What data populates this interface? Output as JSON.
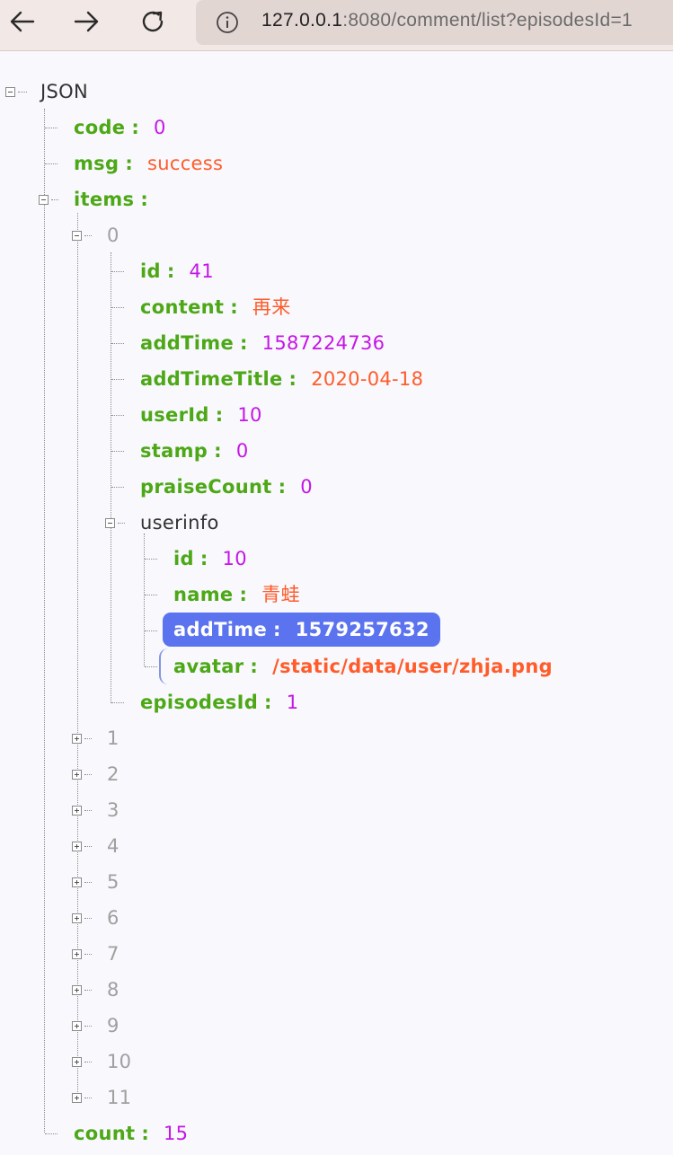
{
  "browser": {
    "url_host": "127.0.0.1",
    "url_rest": ":8080/comment/list?episodesId=1"
  },
  "tree": {
    "root_label": "JSON",
    "separator": ":",
    "code": {
      "key": "code",
      "value": "0"
    },
    "msg": {
      "key": "msg",
      "value": "success"
    },
    "items": {
      "key": "items",
      "first_item": {
        "index": "0",
        "id": {
          "key": "id",
          "value": "41"
        },
        "content": {
          "key": "content",
          "value": "再来"
        },
        "addTime": {
          "key": "addTime",
          "value": "1587224736"
        },
        "addTimeTitle": {
          "key": "addTimeTitle",
          "value": "2020-04-18"
        },
        "userId": {
          "key": "userId",
          "value": "10"
        },
        "stamp": {
          "key": "stamp",
          "value": "0"
        },
        "praiseCount": {
          "key": "praiseCount",
          "value": "0"
        },
        "userinfo": {
          "label": "userinfo",
          "id": {
            "key": "id",
            "value": "10"
          },
          "name": {
            "key": "name",
            "value": "青蛙"
          },
          "addTime": {
            "key": "addTime",
            "value": "1579257632"
          },
          "avatar": {
            "key": "avatar",
            "value": "/static/data/user/zhja.png"
          }
        },
        "episodesId": {
          "key": "episodesId",
          "value": "1"
        }
      },
      "collapsed_indices": [
        "1",
        "2",
        "3",
        "4",
        "5",
        "6",
        "7",
        "8",
        "9",
        "10",
        "11"
      ]
    },
    "count": {
      "key": "count",
      "value": "15"
    }
  }
}
